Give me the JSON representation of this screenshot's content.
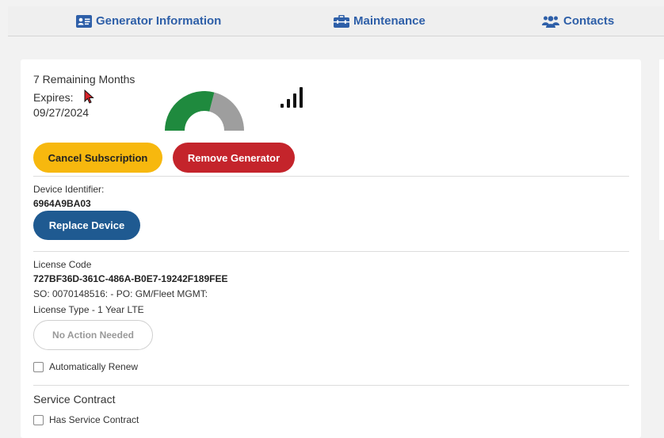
{
  "tabs": [
    {
      "label": "Generator Information",
      "icon": "id-card-icon"
    },
    {
      "label": "Maintenance",
      "icon": "toolbox-icon"
    },
    {
      "label": "Contacts",
      "icon": "users-icon"
    }
  ],
  "subscription": {
    "remaining": "7 Remaining Months",
    "expires_label": "Expires:",
    "expires_date": "09/27/2024",
    "gauge_progress": 0.58,
    "gauge_colors": {
      "filled": "#1f8a3e",
      "empty": "#9e9e9e"
    },
    "signal_level": 4,
    "signal_max": 4
  },
  "buttons": {
    "cancel_subscription": "Cancel Subscription",
    "remove_generator": "Remove Generator",
    "replace_device": "Replace Device",
    "no_action": "No Action Needed"
  },
  "device": {
    "label": "Device Identifier:",
    "value": "6964A9BA03"
  },
  "license": {
    "label": "License Code",
    "code": "727BF36D-361C-486A-B0E7-19242F189FEE",
    "so_po": "SO: 0070148516: - PO: GM/Fleet MGMT:",
    "type": "License Type - 1 Year LTE",
    "auto_renew_label": "Automatically Renew",
    "auto_renew_checked": false
  },
  "service_contract": {
    "heading": "Service Contract",
    "has_contract_label": "Has Service Contract",
    "has_contract_checked": false
  },
  "colors": {
    "tab_text": "#2e5fa8",
    "cancel": "#f7b80e",
    "remove": "#c4242b",
    "replace": "#1f5a91"
  }
}
